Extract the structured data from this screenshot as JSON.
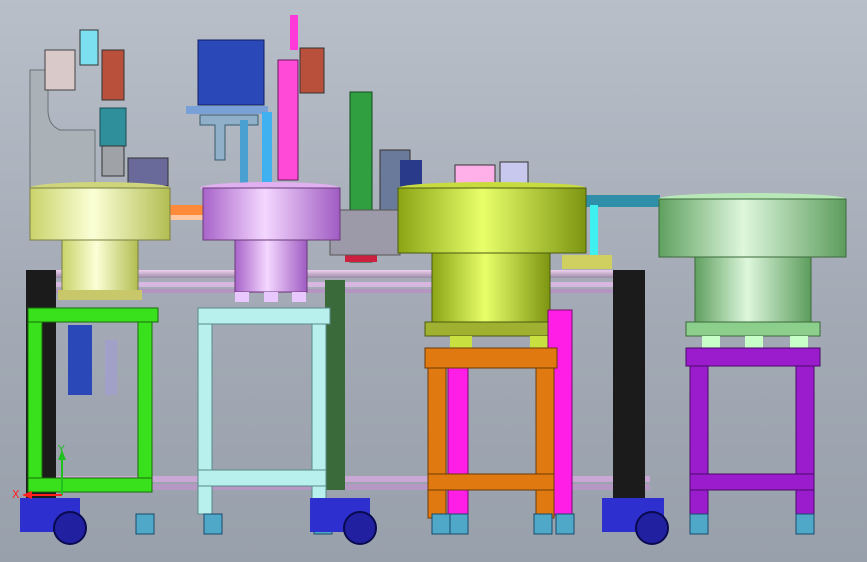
{
  "viewport": {
    "background": "#a8aeb8"
  },
  "colors": {
    "frame_green": "#39e01c",
    "frame_cyan": "#b8f0ee",
    "frame_orange": "#e07a10",
    "frame_purple": "#9a1ccc",
    "frame_magenta": "#ff1ee6",
    "bowl_yellow": "#e7ef9c",
    "bowl_violet": "#d49af0",
    "bowl_olive": "#b5d02a",
    "bowl_green": "#a7dca6",
    "motor_blue": "#2a48b8",
    "plate_gray": "#aab2c8",
    "caster_blue": "#2d2fcf"
  },
  "triad": {
    "x_label": "X",
    "y_label": "Y",
    "x_color": "#ff2020",
    "y_color": "#20c020"
  },
  "icons": [
    "triad-icon"
  ]
}
